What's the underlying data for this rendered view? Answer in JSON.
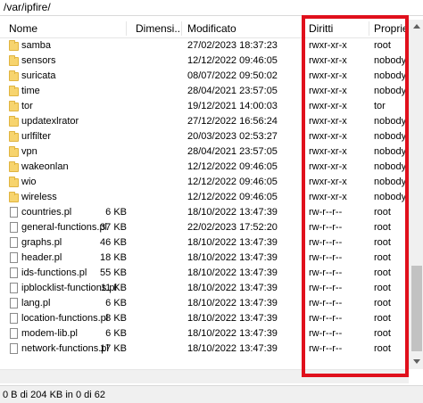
{
  "path": "/var/ipfire/",
  "columns": {
    "name": "Nome",
    "size": "Dimensi...",
    "modified": "Modificato",
    "permissions": "Diritti",
    "owner": "Proprie..."
  },
  "rows": [
    {
      "type": "folder",
      "name": "samba",
      "size": "",
      "modified": "27/02/2023 18:37:23",
      "permissions": "rwxr-xr-x",
      "owner": "root"
    },
    {
      "type": "folder",
      "name": "sensors",
      "size": "",
      "modified": "12/12/2022 09:46:05",
      "permissions": "rwxr-xr-x",
      "owner": "nobody"
    },
    {
      "type": "folder",
      "name": "suricata",
      "size": "",
      "modified": "08/07/2022 09:50:02",
      "permissions": "rwxr-xr-x",
      "owner": "nobody"
    },
    {
      "type": "folder",
      "name": "time",
      "size": "",
      "modified": "28/04/2021 23:57:05",
      "permissions": "rwxr-xr-x",
      "owner": "nobody"
    },
    {
      "type": "folder",
      "name": "tor",
      "size": "",
      "modified": "19/12/2021 14:00:03",
      "permissions": "rwxr-xr-x",
      "owner": "tor"
    },
    {
      "type": "folder",
      "name": "updatexlrator",
      "size": "",
      "modified": "27/12/2022 16:56:24",
      "permissions": "rwxr-xr-x",
      "owner": "nobody"
    },
    {
      "type": "folder",
      "name": "urlfilter",
      "size": "",
      "modified": "20/03/2023 02:53:27",
      "permissions": "rwxr-xr-x",
      "owner": "nobody"
    },
    {
      "type": "folder",
      "name": "vpn",
      "size": "",
      "modified": "28/04/2021 23:57:05",
      "permissions": "rwxr-xr-x",
      "owner": "nobody"
    },
    {
      "type": "folder",
      "name": "wakeonlan",
      "size": "",
      "modified": "12/12/2022 09:46:05",
      "permissions": "rwxr-xr-x",
      "owner": "nobody"
    },
    {
      "type": "folder",
      "name": "wio",
      "size": "",
      "modified": "12/12/2022 09:46:05",
      "permissions": "rwxr-xr-x",
      "owner": "nobody"
    },
    {
      "type": "folder",
      "name": "wireless",
      "size": "",
      "modified": "12/12/2022 09:46:05",
      "permissions": "rwxr-xr-x",
      "owner": "nobody"
    },
    {
      "type": "file",
      "name": "countries.pl",
      "size": "6 KB",
      "modified": "18/10/2022 13:47:39",
      "permissions": "rw-r--r--",
      "owner": "root"
    },
    {
      "type": "file",
      "name": "general-functions.pl",
      "size": "37 KB",
      "modified": "22/02/2023 17:52:20",
      "permissions": "rw-r--r--",
      "owner": "root"
    },
    {
      "type": "file",
      "name": "graphs.pl",
      "size": "46 KB",
      "modified": "18/10/2022 13:47:39",
      "permissions": "rw-r--r--",
      "owner": "root"
    },
    {
      "type": "file",
      "name": "header.pl",
      "size": "18 KB",
      "modified": "18/10/2022 13:47:39",
      "permissions": "rw-r--r--",
      "owner": "root"
    },
    {
      "type": "file",
      "name": "ids-functions.pl",
      "size": "55 KB",
      "modified": "18/10/2022 13:47:39",
      "permissions": "rw-r--r--",
      "owner": "root"
    },
    {
      "type": "file",
      "name": "ipblocklist-functions.pl",
      "size": "11 KB",
      "modified": "18/10/2022 13:47:39",
      "permissions": "rw-r--r--",
      "owner": "root"
    },
    {
      "type": "file",
      "name": "lang.pl",
      "size": "6 KB",
      "modified": "18/10/2022 13:47:39",
      "permissions": "rw-r--r--",
      "owner": "root"
    },
    {
      "type": "file",
      "name": "location-functions.pl",
      "size": "8 KB",
      "modified": "18/10/2022 13:47:39",
      "permissions": "rw-r--r--",
      "owner": "root"
    },
    {
      "type": "file",
      "name": "modem-lib.pl",
      "size": "6 KB",
      "modified": "18/10/2022 13:47:39",
      "permissions": "rw-r--r--",
      "owner": "root"
    },
    {
      "type": "file",
      "name": "network-functions.pl",
      "size": "17 KB",
      "modified": "18/10/2022 13:47:39",
      "permissions": "rw-r--r--",
      "owner": "root"
    }
  ],
  "status": "0 B di 204 KB in 0 di 62",
  "highlight_color": "#e0101c",
  "folder_icon_color": "#f7d46e"
}
